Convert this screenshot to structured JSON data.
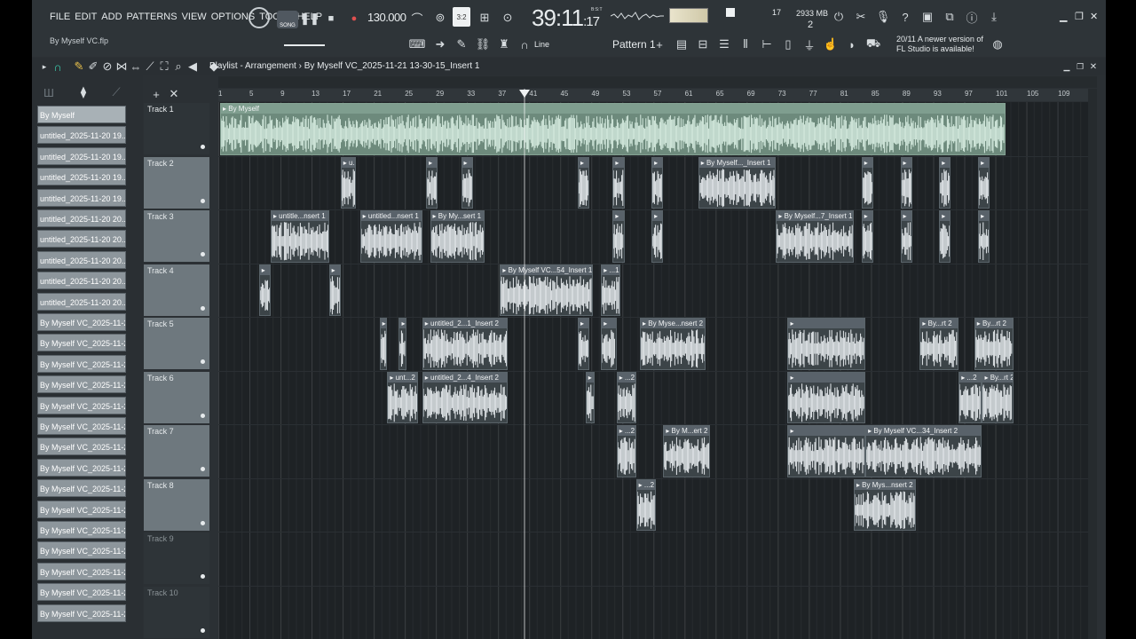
{
  "menu": [
    "FILE",
    "EDIT",
    "ADD",
    "PATTERNS",
    "VIEW",
    "OPTIONS",
    "TOOLS",
    "HELP"
  ],
  "project_file": "By Myself VC.flp",
  "transport": {
    "song_label": "SONG",
    "tempo": "130.000",
    "time_main": "39:11",
    "time_sub": ":17",
    "time_unit": "B:S:T",
    "cpu_voices": "17",
    "memory": "2933 MB",
    "polyphony": "2",
    "snap": "Line",
    "pattern": "Pattern 1"
  },
  "news": {
    "count": "20/11",
    "text": "A newer version of FL Studio is available!"
  },
  "playlist": {
    "title": "Playlist - Arrangement",
    "sep": "›",
    "arrangement": "By Myself VC_2025-11-21 13-30-15_Insert 1"
  },
  "ruler": [
    "1",
    "5",
    "9",
    "13",
    "17",
    "21",
    "25",
    "29",
    "33",
    "37",
    "41",
    "45",
    "49",
    "53",
    "57",
    "61",
    "65",
    "69",
    "73",
    "77",
    "81",
    "85",
    "89",
    "93",
    "97",
    "101",
    "105",
    "109"
  ],
  "clip_list": [
    "By Myself",
    "untitled_2025-11-20 19...",
    "untitled_2025-11-20 19...",
    "untitled_2025-11-20 19...",
    "untitled_2025-11-20 19...",
    "untitled_2025-11-20 20...",
    "untitled_2025-11-20 20...",
    "untitled_2025-11-20 20...",
    "untitled_2025-11-20 20...",
    "untitled_2025-11-20 20...",
    "By Myself VC_2025-11-2...",
    "By Myself VC_2025-11-2...",
    "By Myself VC_2025-11-2...",
    "By Myself VC_2025-11-2...",
    "By Myself VC_2025-11-2...",
    "By Myself VC_2025-11-2...",
    "By Myself VC_2025-11-2...",
    "By Myself VC_2025-11-2...",
    "By Myself VC_2025-11-2...",
    "By Myself VC_2025-11-2...",
    "By Myself VC_2025-11-2...",
    "By Myself VC_2025-11-2...",
    "By Myself VC_2025-11-2...",
    "By Myself VC_2025-11-2...",
    "By Myself VC_2025-11-2..."
  ],
  "tracks": [
    "Track 1",
    "Track 2",
    "Track 3",
    "Track 4",
    "Track 5",
    "Track 6",
    "Track 7",
    "Track 8",
    "Track 9",
    "Track 10"
  ],
  "clips": [
    {
      "track": 0,
      "bar": 1,
      "len": 101,
      "label": "By Myself",
      "big": true
    },
    {
      "track": 1,
      "bar": 16.5,
      "len": 2,
      "label": "u..."
    },
    {
      "track": 1,
      "bar": 27.5,
      "len": 1.5,
      "label": ""
    },
    {
      "track": 1,
      "bar": 32,
      "len": 1.5,
      "label": ""
    },
    {
      "track": 1,
      "bar": 47,
      "len": 1.5,
      "label": ""
    },
    {
      "track": 1,
      "bar": 51.5,
      "len": 1.5,
      "label": ""
    },
    {
      "track": 1,
      "bar": 56.5,
      "len": 1.5,
      "label": ""
    },
    {
      "track": 1,
      "bar": 62.5,
      "len": 10,
      "label": "By Myself..._Insert 1"
    },
    {
      "track": 1,
      "bar": 83.5,
      "len": 1.5,
      "label": ""
    },
    {
      "track": 1,
      "bar": 88.5,
      "len": 1.5,
      "label": ""
    },
    {
      "track": 1,
      "bar": 93.5,
      "len": 1.5,
      "label": ""
    },
    {
      "track": 1,
      "bar": 98.5,
      "len": 1.5,
      "label": ""
    },
    {
      "track": 2,
      "bar": 7.5,
      "len": 7.5,
      "label": "untitle...nsert 1"
    },
    {
      "track": 2,
      "bar": 19,
      "len": 8,
      "label": "untitled...nsert 1"
    },
    {
      "track": 2,
      "bar": 28,
      "len": 7,
      "label": "By My...sert 1"
    },
    {
      "track": 2,
      "bar": 51.5,
      "len": 1.5,
      "label": ""
    },
    {
      "track": 2,
      "bar": 56.5,
      "len": 1.5,
      "label": ""
    },
    {
      "track": 2,
      "bar": 72.5,
      "len": 10,
      "label": "By Myself...7_Insert 1"
    },
    {
      "track": 2,
      "bar": 83.5,
      "len": 1.5,
      "label": ""
    },
    {
      "track": 2,
      "bar": 88.5,
      "len": 1.5,
      "label": ""
    },
    {
      "track": 2,
      "bar": 93.5,
      "len": 1.5,
      "label": ""
    },
    {
      "track": 2,
      "bar": 98.5,
      "len": 1.5,
      "label": ""
    },
    {
      "track": 3,
      "bar": 6,
      "len": 1.5,
      "label": ""
    },
    {
      "track": 3,
      "bar": 15,
      "len": 1.5,
      "label": ""
    },
    {
      "track": 3,
      "bar": 37,
      "len": 12,
      "label": "By Myself VC...54_Insert 1"
    },
    {
      "track": 3,
      "bar": 50,
      "len": 2.5,
      "label": "...1"
    },
    {
      "track": 4,
      "bar": 21.5,
      "len": 1,
      "label": ""
    },
    {
      "track": 4,
      "bar": 24,
      "len": 1,
      "label": ""
    },
    {
      "track": 4,
      "bar": 27,
      "len": 11,
      "label": "untitled_2...1_Insert 2"
    },
    {
      "track": 4,
      "bar": 47,
      "len": 1.5,
      "label": ""
    },
    {
      "track": 4,
      "bar": 50,
      "len": 2,
      "label": ""
    },
    {
      "track": 4,
      "bar": 55,
      "len": 8.5,
      "label": "By Myse...nsert 2"
    },
    {
      "track": 4,
      "bar": 74,
      "len": 10,
      "label": ""
    },
    {
      "track": 4,
      "bar": 91,
      "len": 5,
      "label": "By...rt 2"
    },
    {
      "track": 4,
      "bar": 98,
      "len": 5,
      "label": "By...rt 2"
    },
    {
      "track": 5,
      "bar": 22.5,
      "len": 4,
      "label": "unt...2"
    },
    {
      "track": 5,
      "bar": 27,
      "len": 11,
      "label": "untitled_2...4_Insert 2"
    },
    {
      "track": 5,
      "bar": 48,
      "len": 1.2,
      "label": ""
    },
    {
      "track": 5,
      "bar": 52,
      "len": 2.5,
      "label": "...2"
    },
    {
      "track": 5,
      "bar": 74,
      "len": 10,
      "label": ""
    },
    {
      "track": 5,
      "bar": 96,
      "len": 3,
      "label": "...2"
    },
    {
      "track": 5,
      "bar": 99,
      "len": 4,
      "label": "By...rt 2"
    },
    {
      "track": 6,
      "bar": 52,
      "len": 2.5,
      "label": "...2"
    },
    {
      "track": 6,
      "bar": 58,
      "len": 6,
      "label": "By M...ert 2"
    },
    {
      "track": 6,
      "bar": 74,
      "len": 10,
      "label": ""
    },
    {
      "track": 6,
      "bar": 84,
      "len": 15,
      "label": "By Myself VC...34_Insert 2"
    },
    {
      "track": 7,
      "bar": 54.5,
      "len": 2.5,
      "label": "...2"
    },
    {
      "track": 7,
      "bar": 82.5,
      "len": 8,
      "label": "By Mys...nsert 2"
    }
  ]
}
